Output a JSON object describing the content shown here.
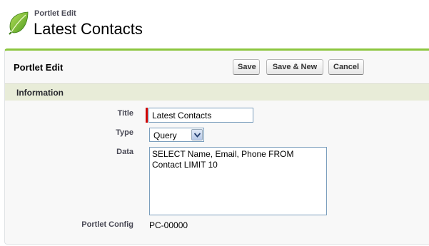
{
  "header": {
    "subtitle": "Portlet Edit",
    "title": "Latest Contacts"
  },
  "panel": {
    "title": "Portlet Edit",
    "buttons": {
      "save": "Save",
      "save_new": "Save & New",
      "cancel": "Cancel"
    }
  },
  "section": {
    "label": "Information"
  },
  "fields": {
    "title": {
      "label": "Title",
      "value": "Latest Contacts"
    },
    "type": {
      "label": "Type",
      "value": "Query"
    },
    "data": {
      "label": "Data",
      "value": "SELECT Name, Email, Phone FROM\nContact LIMIT 10"
    },
    "config": {
      "label": "Portlet Config",
      "value": "PC-00000"
    }
  },
  "colors": {
    "accent_green": "#8cc63f",
    "section_bg": "#e8ecd8",
    "required": "#cc0000"
  }
}
